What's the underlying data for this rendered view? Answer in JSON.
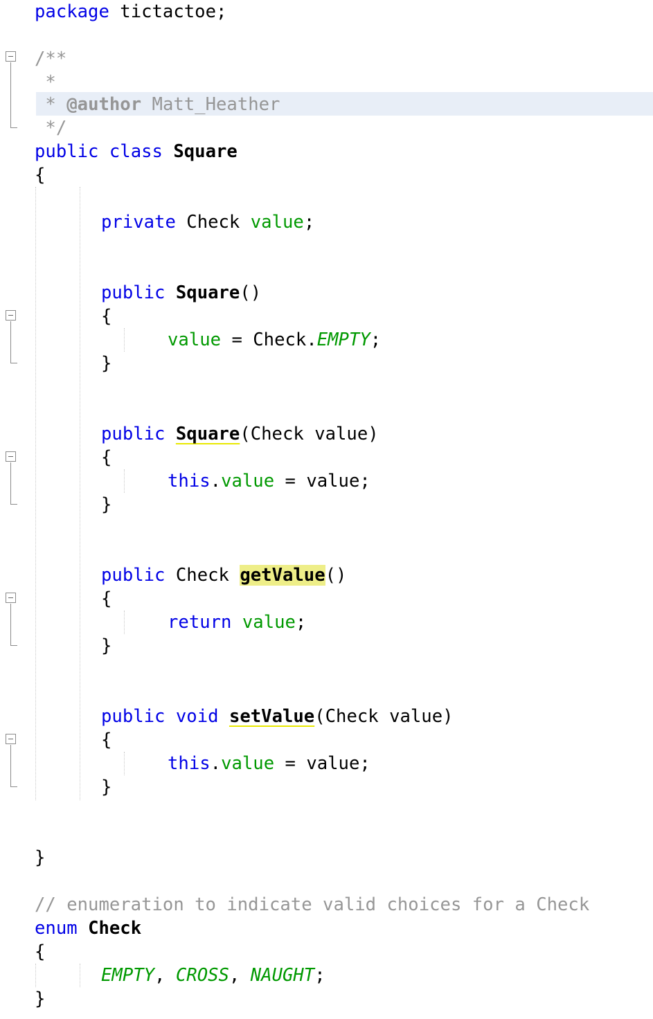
{
  "editor": {
    "package_keyword": "package",
    "package_name": "tictactoe;",
    "javadoc": {
      "open": "/**",
      "blank": " *",
      "star": " *",
      "author_tag": "@author",
      "author_name": "Matt_Heather",
      "close": " */"
    },
    "class_decl": {
      "modifier": "public",
      "keyword": "class",
      "name": "Square"
    },
    "field": {
      "modifier": "private",
      "type": "Check",
      "name": "value"
    },
    "ctor_default": {
      "modifier": "public",
      "name": "Square",
      "params": "()",
      "body_field": "value",
      "body_rest": " = Check.",
      "body_const": "EMPTY"
    },
    "ctor_param": {
      "modifier": "public",
      "name": "Square",
      "params": "(Check value)",
      "this_kw": "this",
      "field": "value",
      "rhs": " = value;"
    },
    "getter": {
      "modifier": "public",
      "return_type": "Check",
      "name": "getValue",
      "params": "()",
      "return_kw": "return",
      "field": "value"
    },
    "setter": {
      "modifier": "public",
      "return_type": "void",
      "name": "setValue",
      "params": "(Check value)",
      "this_kw": "this",
      "field": "value",
      "rhs": " = value;"
    },
    "comment": "// enumeration to indicate valid choices for a Check",
    "enum_decl": {
      "keyword": "enum",
      "name": "Check"
    },
    "enum_values": [
      "EMPTY",
      "CROSS",
      "NAUGHT"
    ],
    "punct": {
      "open_brace": "{",
      "close_brace": "}",
      "semicolon": ";",
      "dot": ".",
      "comma": ", "
    },
    "colors": {
      "keyword": "#0000e6",
      "field": "#009900",
      "comment": "#969696",
      "current_line": "#e8eef7",
      "occurrence_mark": "#eeee88"
    }
  }
}
